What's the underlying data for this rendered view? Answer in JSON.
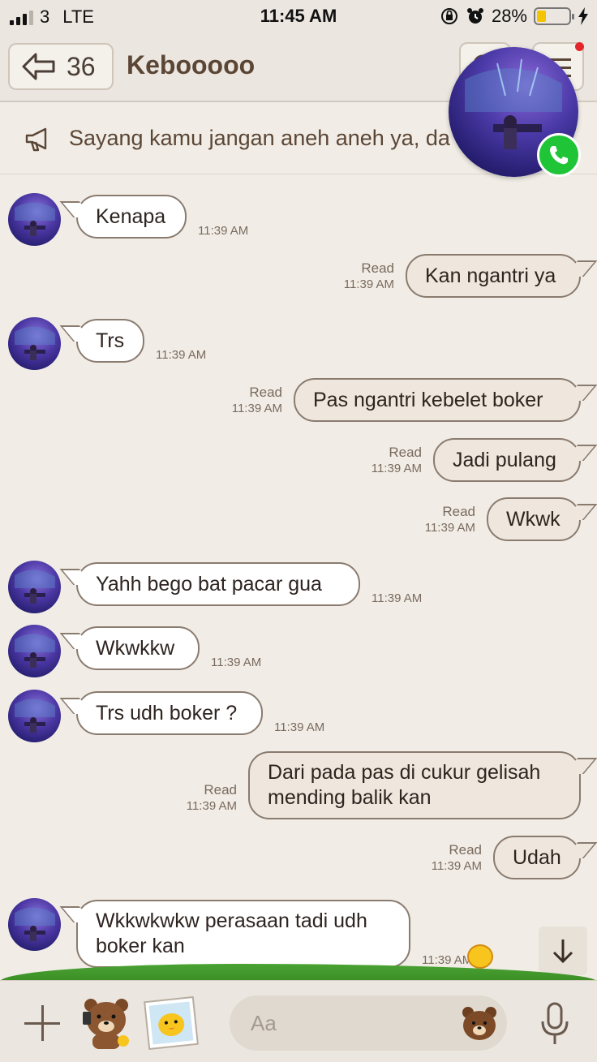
{
  "status_bar": {
    "carrier": "3",
    "network": "LTE",
    "time": "11:45 AM",
    "battery": "28%",
    "battery_level": 0.28
  },
  "header": {
    "back_count": "36",
    "title": "Kebooooo"
  },
  "announcement": {
    "text": "Sayang kamu jangan aneh aneh ya, da"
  },
  "messages": [
    {
      "dir": "in",
      "text": "Kenapa",
      "time": "11:39 AM"
    },
    {
      "dir": "out",
      "text": "Kan ngantri ya",
      "time": "11:39 AM",
      "status": "Read"
    },
    {
      "dir": "in",
      "text": "Trs",
      "time": "11:39 AM"
    },
    {
      "dir": "out",
      "text": "Pas ngantri kebelet boker",
      "time": "11:39 AM",
      "status": "Read"
    },
    {
      "dir": "out",
      "text": "Jadi pulang",
      "time": "11:39 AM",
      "status": "Read"
    },
    {
      "dir": "out",
      "text": "Wkwk",
      "time": "11:39 AM",
      "status": "Read"
    },
    {
      "dir": "in",
      "text": "Yahh bego bat pacar gua",
      "time": "11:39 AM"
    },
    {
      "dir": "in",
      "text": "Wkwkkw",
      "time": "11:39 AM"
    },
    {
      "dir": "in",
      "text": "Trs udh boker ?",
      "time": "11:39 AM"
    },
    {
      "dir": "out",
      "lines": [
        "Dari pada pas di cukur gelisah",
        "mending balik kan"
      ],
      "time": "11:39 AM",
      "status": "Read"
    },
    {
      "dir": "out",
      "text": "Udah",
      "time": "11:39 AM",
      "status": "Read"
    },
    {
      "dir": "in",
      "lines": [
        "Wkkwkwkw perasaan tadi udh",
        "boker kan"
      ],
      "time": "11:39 AM"
    }
  ],
  "input": {
    "placeholder": "Aa"
  },
  "colors": {
    "background": "#f1ede6",
    "header": "#ebe6df",
    "bubble_in": "#ffffff",
    "bubble_out": "#efe7dd",
    "bubble_border": "#8a7b6f",
    "title": "#5b4636",
    "call_green": "#1fc437",
    "grass": "#4aa233"
  },
  "icons": [
    "back-arrow-icon",
    "search-icon",
    "menu-icon",
    "megaphone-icon",
    "phone-icon",
    "arrow-down-icon",
    "plus-icon",
    "brown-bear-sticker-icon",
    "sally-chick-sticker-icon",
    "brown-bear-emoji-icon",
    "microphone-icon"
  ]
}
